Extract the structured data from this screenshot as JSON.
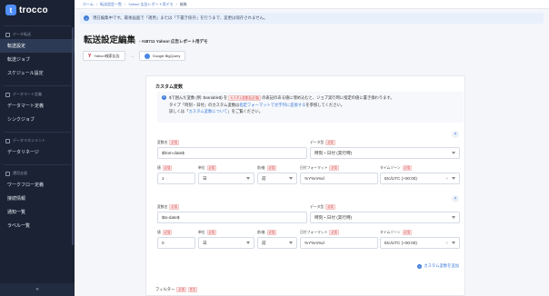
{
  "brand": {
    "name": "trocco"
  },
  "sidebar": {
    "sections": [
      {
        "label": "データ転送",
        "items": [
          "転送設定",
          "転送ジョブ",
          "スケジュール設定"
        ]
      },
      {
        "label": "データマート定義",
        "items": [
          "データマート定義",
          "シンクジョブ"
        ]
      },
      {
        "label": "データマネジメント",
        "items": [
          "データリネージ"
        ]
      },
      {
        "label": "運用支援",
        "items": [
          "ワークフロー定義",
          "接続情報",
          "通知一覧",
          "ラベル一覧"
        ]
      }
    ],
    "collapse_label": "«"
  },
  "breadcrumb": [
    "ホーム",
    "転送設定一覧",
    "Yahoo! 広告レポート用デモ",
    "編集"
  ],
  "alert": {
    "text": "現在編集中です。最後画面で「適用」または「下書き保存」を行うまで、変更は保存されません。"
  },
  "page": {
    "title": "転送設定編集",
    "subtitle": "- #48711 Yahoo! 広告レポート用デモ",
    "source": "Yahoo!検索広告",
    "destination": "Google BigQuery"
  },
  "custom_vars": {
    "title": "カスタム変数",
    "note_line1_a": "$で囲んだ変数 (例: $variable$) を",
    "note_code": "カスタム変数名(必須)",
    "note_line1_b": "の表記のある値に埋め込むと、ジョブ実行時に指定の値に置き換わります。",
    "note_line2_a": "タイプ「時刻・日付」のカスタム変数は",
    "note_link2": "指定フォーマットで文字列に変換する",
    "note_line2_b": "を参照してください。",
    "note_line3_a": "詳しくは「",
    "note_link3": "カスタム変数について",
    "note_line3_b": "」をご覧ください。",
    "labels": {
      "name": "変数名",
      "type": "データ型",
      "value": "値",
      "unit": "単位",
      "direction": "前/後",
      "format": "日付フォーマット",
      "timezone": "タイムゾーン",
      "required": "必須"
    },
    "vars": [
      {
        "name": "$from-date$",
        "type": "時刻・日付 (実行時)",
        "value": "1",
        "unit": "日",
        "direction": "前",
        "format": "%Y%m%d",
        "timezone": "Etc/UTC (+00:00)"
      },
      {
        "name": "$to-date$",
        "type": "時刻・日付 (実行時)",
        "value": "0",
        "unit": "日",
        "direction": "前",
        "format": "%Y%m%d",
        "timezone": "Etc/UTC (+00:00)"
      }
    ],
    "add_label": "カスタム変数を追加"
  },
  "footer": {
    "label": "フィルター",
    "tags": [
      "必須",
      "任意"
    ]
  },
  "colors": {
    "sidebar_bg": "#1a2233",
    "accent": "#3d7bd9",
    "required_red": "#d23a3a"
  }
}
